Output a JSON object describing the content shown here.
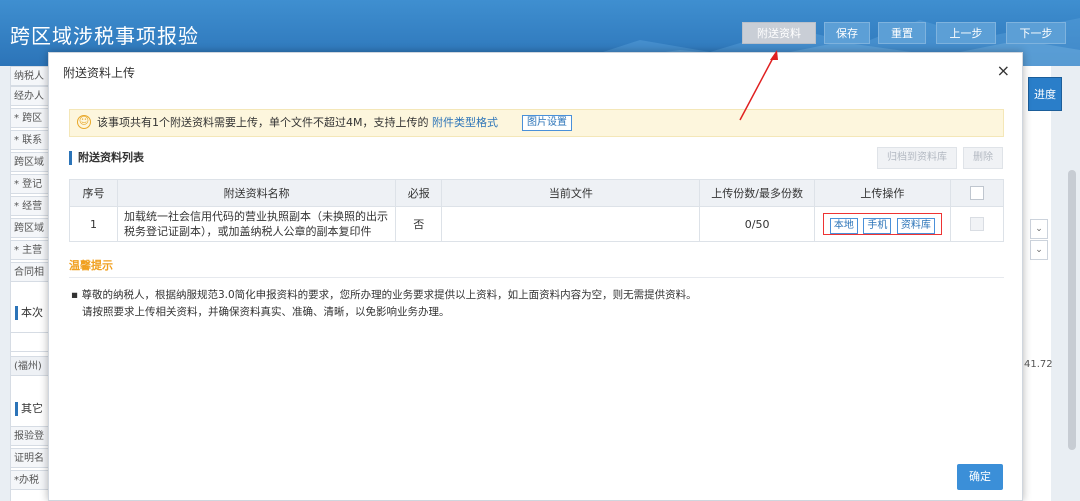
{
  "header": {
    "title": "跨区域涉税事项报验",
    "buttons": [
      "附送资料",
      "保存",
      "重置",
      "上一步",
      "下一步"
    ]
  },
  "background": {
    "rows": [
      {
        "label": "纳税人"
      },
      {
        "label": "经办人"
      },
      {
        "label": "* 跨区"
      },
      {
        "label": "* 联系"
      },
      {
        "label": "跨区域"
      },
      {
        "label": "* 登记"
      },
      {
        "label": "* 经营"
      },
      {
        "label": "跨区域"
      },
      {
        "label": "* 主营"
      },
      {
        "label": "合同相"
      }
    ],
    "section1": "本次",
    "row_fuzhou": "(福州)",
    "section2": "其它",
    "rows2": [
      {
        "label": "报验登"
      },
      {
        "label": "证明名"
      },
      {
        "label": "*办税"
      }
    ],
    "progress_label": "进度",
    "right_value": "41.72"
  },
  "modal": {
    "title": "附送资料上传",
    "close": "×",
    "notice": {
      "prefix": "该事项共有1个附送资料需要上传，单个文件不超过4M，支持上传的",
      "link": "附件类型格式",
      "image_settings": "图片设置"
    },
    "list_title": "附送资料列表",
    "archive_button": "归档到资料库",
    "delete_button": "删除",
    "table": {
      "headers": [
        "序号",
        "附送资料名称",
        "必报",
        "当前文件",
        "上传份数/最多份数",
        "上传操作"
      ],
      "rows": [
        {
          "index": "1",
          "name": "加载统一社会信用代码的营业执照副本（未换照的出示税务登记证副本），或加盖纳税人公章的副本复印件",
          "required": "否",
          "current_file": "",
          "count": "0/50",
          "ops": [
            "本地",
            "手机",
            "资料库"
          ]
        }
      ]
    },
    "tips_title": "温馨提示",
    "tips": [
      "▪ 尊敬的纳税人，根据纳服规范3.0简化申报资料的要求，您所办理的业务要求提供以上资料，如上面资料内容为空，则无需提供资料。",
      "请按照要求上传相关资料，并确保资料真实、准确、清晰，以免影响业务办理。"
    ],
    "confirm": "确定"
  }
}
